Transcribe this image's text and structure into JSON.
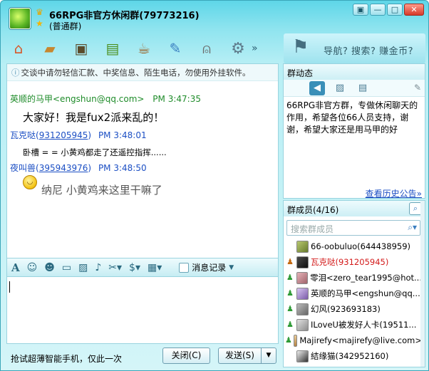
{
  "window": {
    "title": "66RPG非官方休闲群(79773216)",
    "subtitle": "(普通群)",
    "buttons": [
      "▣",
      "—",
      "□",
      "✕"
    ]
  },
  "toolbar": {
    "icons": [
      "home-icon",
      "folder-icon",
      "picture-icon",
      "tv-icon",
      "cup-icon",
      "note-icon",
      "mic-icon",
      "gear-icon"
    ],
    "more": "»"
  },
  "banner": {
    "text": "导航? 搜索? 赚金币?"
  },
  "notice": "交谈中请勿轻信汇款、中奖信息、陌生电话，勿使用外挂软件。",
  "messages": [
    {
      "sender": "英顺的马甲<engshun@qq.com>",
      "time": "PM 3:47:35",
      "text": "大家好！我是fux2派来乱的！"
    },
    {
      "sender_name": "瓦克哒",
      "sender_id": "931205945",
      "time": "PM 3:48:01",
      "text": "卧槽 = = 小黄鸡都走了还遥控指挥......"
    },
    {
      "sender_name": "夜叫兽",
      "sender_id": "395943976",
      "time": "PM 3:48:50",
      "text": "纳尼  小黄鸡来这里干嘛了"
    }
  ],
  "format_bar": {
    "msg_record": "消息记录"
  },
  "bottom": {
    "ad": "抢试超薄智能手机，仅此一次",
    "close_label": "关闭(C)",
    "send_label": "发送(S)"
  },
  "group_news": {
    "title": "群动态",
    "announcement": "66RPG非官方群，专做休闲聊天的作用，希望各位66人员支持，谢谢，希望大家还是用马甲的好",
    "history_link": "查看历史公告»"
  },
  "members": {
    "title": "群成员(4/16)",
    "search_placeholder": "搜索群成员",
    "list": [
      {
        "role": "",
        "name": "66-oobuluo(644438959)",
        "red": false
      },
      {
        "role": "owner",
        "name": "瓦克哒(931205945)",
        "red": true
      },
      {
        "role": "admin",
        "name": "零泪<zero_tear1995@hot...",
        "red": false
      },
      {
        "role": "admin",
        "name": "英顺的马甲<engshun@qq...",
        "red": false
      },
      {
        "role": "admin",
        "name": "幻风(923693183)",
        "red": false
      },
      {
        "role": "admin",
        "name": "ILoveU被发好人卡(19511...",
        "red": false
      },
      {
        "role": "admin",
        "name": "Majirefy<majirefy@live.com>",
        "red": false
      },
      {
        "role": "",
        "name": "結缘猫(342952160)",
        "red": false
      }
    ]
  }
}
